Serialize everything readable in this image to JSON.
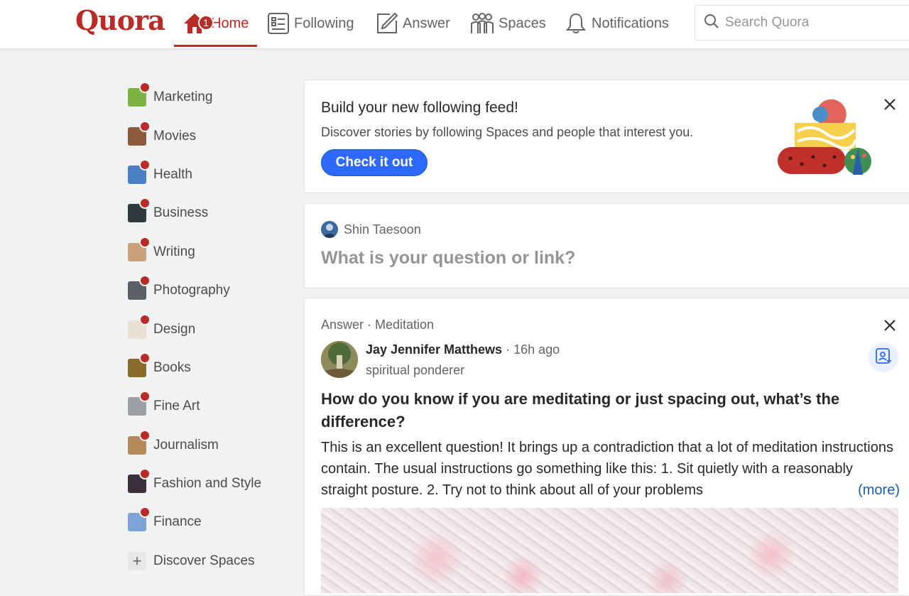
{
  "header": {
    "logo": "Quora",
    "nav": [
      {
        "label": "Home",
        "icon": "home-icon",
        "badge": "1",
        "active": true
      },
      {
        "label": "Following",
        "icon": "following-icon"
      },
      {
        "label": "Answer",
        "icon": "answer-pencil-icon"
      },
      {
        "label": "Spaces",
        "icon": "spaces-people-icon"
      },
      {
        "label": "Notifications",
        "icon": "bell-icon"
      }
    ],
    "search_placeholder": "Search Quora"
  },
  "sidebar": {
    "items": [
      {
        "label": "Marketing",
        "color": "#7cb342"
      },
      {
        "label": "Movies",
        "color": "#8d5a3b"
      },
      {
        "label": "Health",
        "color": "#4a7fc1"
      },
      {
        "label": "Business",
        "color": "#2f3a3f"
      },
      {
        "label": "Writing",
        "color": "#c9a27a"
      },
      {
        "label": "Photography",
        "color": "#5b5f66"
      },
      {
        "label": "Design",
        "color": "#e9e2d4"
      },
      {
        "label": "Books",
        "color": "#8a6a2c"
      },
      {
        "label": "Fine Art",
        "color": "#9aa0a6"
      },
      {
        "label": "Journalism",
        "color": "#b48a5a"
      },
      {
        "label": "Fashion and Style",
        "color": "#3a2f3a"
      },
      {
        "label": "Finance",
        "color": "#7ea3d6"
      }
    ],
    "discover_label": "Discover Spaces"
  },
  "feed_prompt": {
    "title": "Build your new following feed!",
    "subtitle": "Discover stories by following Spaces and people that interest you.",
    "button": "Check it out"
  },
  "ask_box": {
    "user_name": "Shin Taesoon",
    "placeholder": "What is your question or link?"
  },
  "answer_card": {
    "meta": "Answer · Meditation",
    "author": "Jay Jennifer Matthews",
    "time": " · 16h ago",
    "credential": "spiritual ponderer",
    "question": "How do you know if you are meditating or just spacing out, what’s the difference?",
    "body": "This is an excellent question! It brings up a contradiction that a lot of meditation instructions contain. The usual instructions go something like this: 1. Sit quietly with a reasonably straight posture. 2. Try not to think about all of your problems",
    "more_label": "(more)"
  },
  "colors": {
    "brand": "#b92b27",
    "primary_button": "#2e69ff",
    "link": "#195faa"
  }
}
